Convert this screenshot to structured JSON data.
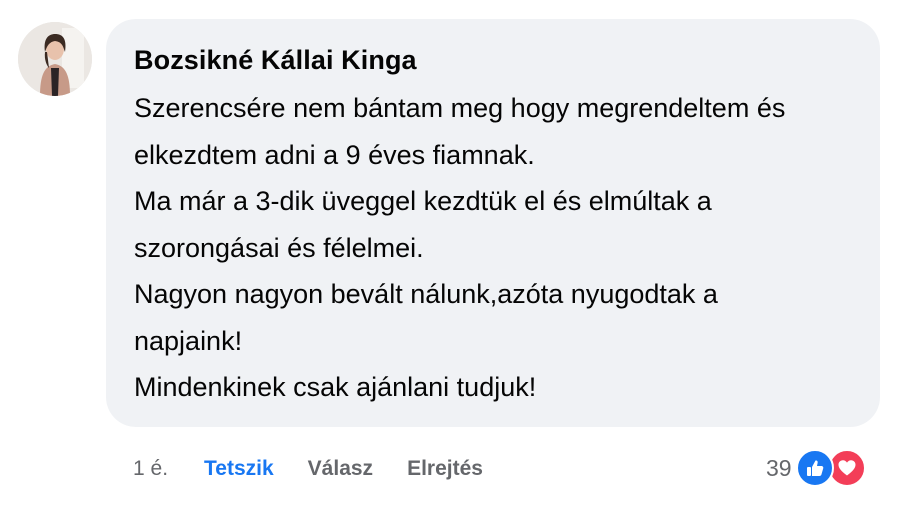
{
  "comment": {
    "author": "Bozsikné Kállai Kinga",
    "lines": [
      "Szerencsére nem bántam meg hogy megrendeltem és",
      "elkezdtem adni a 9 éves fiamnak.",
      "Ma már a 3-dik üveggel kezdtük el és elmúltak a",
      "szorongásai és félelmei.",
      "Nagyon nagyon bevált nálunk,azóta nyugodtak a",
      "napjaink!",
      "Mindenkinek csak ajánlani tudjuk!"
    ]
  },
  "actions": {
    "time": "1 é.",
    "like_label": "Tetszik",
    "reply_label": "Válasz",
    "hide_label": "Elrejtés"
  },
  "reactions": {
    "count": "39",
    "icons": [
      "thumbs-up-icon",
      "heart-icon"
    ],
    "like_color": "#1877f2",
    "love_color": "#f33e58"
  },
  "colors": {
    "bubble_background": "#f0f2f5",
    "text": "#050505",
    "secondary_text": "#65676b",
    "accent": "#1877f2"
  }
}
